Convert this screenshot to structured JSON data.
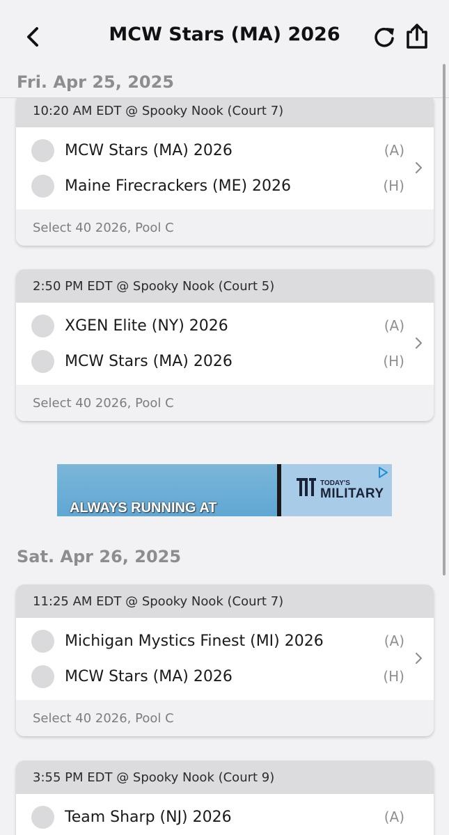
{
  "header": {
    "title": "MCW Stars (MA) 2026",
    "back_icon": "chevron-left-icon",
    "refresh_icon": "refresh-icon",
    "share_icon": "share-icon"
  },
  "days": [
    {
      "label": "Fri. Apr 25, 2025",
      "games": [
        {
          "header": "10:20 AM EDT @ Spooky Nook (Court 7)",
          "teams": [
            {
              "name": "MCW Stars (MA) 2026",
              "tag": "(A)"
            },
            {
              "name": "Maine Firecrackers (ME) 2026",
              "tag": "(H)"
            }
          ],
          "footer": "Select 40 2026, Pool C"
        },
        {
          "header": "2:50 PM EDT @ Spooky Nook (Court 5)",
          "teams": [
            {
              "name": "XGEN Elite (NY) 2026",
              "tag": "(A)"
            },
            {
              "name": "MCW Stars (MA) 2026",
              "tag": "(H)"
            }
          ],
          "footer": "Select 40 2026, Pool C"
        }
      ]
    },
    {
      "label": "Sat. Apr 26, 2025",
      "games": [
        {
          "header": "11:25 AM EDT @ Spooky Nook (Court 7)",
          "teams": [
            {
              "name": "Michigan Mystics Finest (MI) 2026",
              "tag": "(A)"
            },
            {
              "name": "MCW Stars (MA) 2026",
              "tag": "(H)"
            }
          ],
          "footer": "Select 40 2026, Pool C"
        },
        {
          "header": "3:55 PM EDT @ Spooky Nook (Court 9)",
          "teams": [
            {
              "name": "Team Sharp (NJ) 2026",
              "tag": "(A)"
            }
          ]
        }
      ]
    }
  ],
  "ad": {
    "left_text": "ALWAYS RUNNING AT",
    "brand_top": "TODAY'S",
    "brand_main": "MILITARY",
    "choices_icon": "ad-choices-icon"
  },
  "colors": {
    "background": "#f2f2f4",
    "card_header": "#dcdcde",
    "muted_text": "#8d8d90"
  }
}
